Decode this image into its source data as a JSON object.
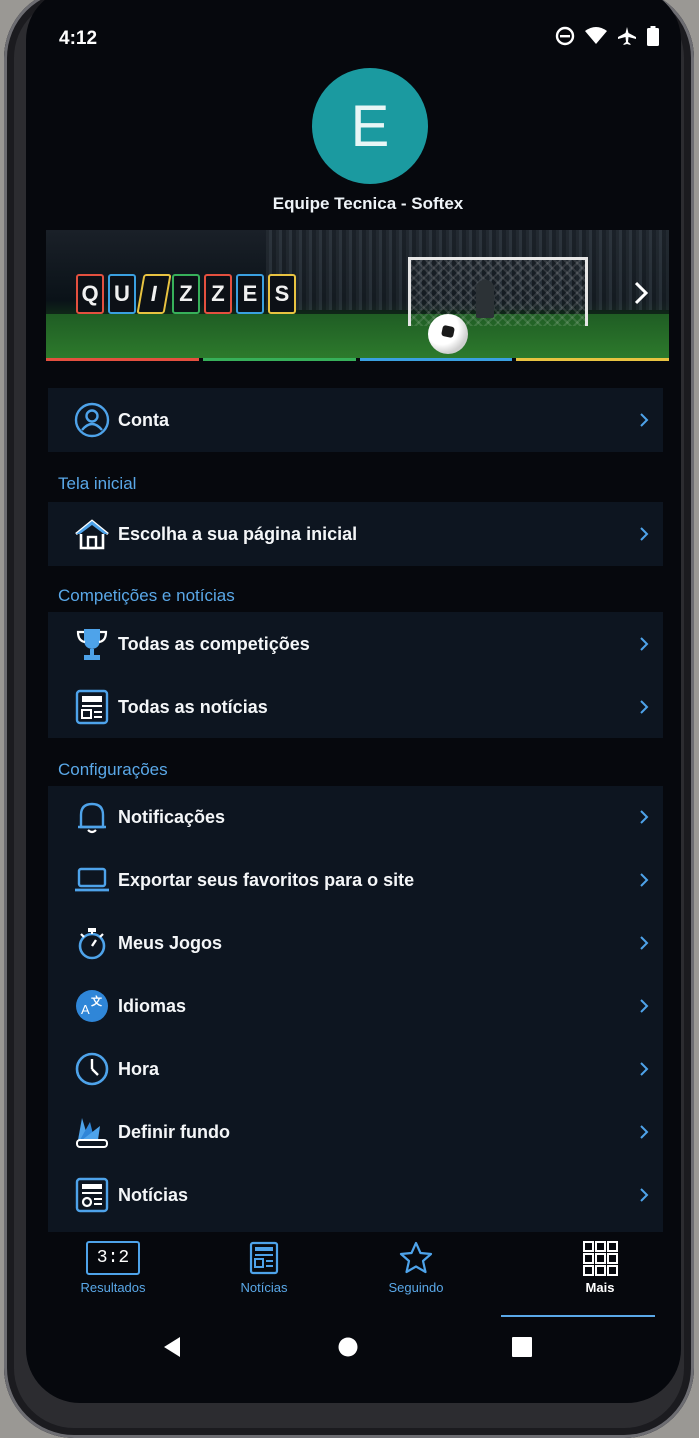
{
  "status_bar": {
    "time": "4:12",
    "icons": [
      "dnd-icon",
      "wifi-icon",
      "airplane-icon",
      "battery-icon"
    ]
  },
  "profile": {
    "initial": "E",
    "name": "Equipe Tecnica - Softex",
    "avatar_color": "#1b9aa0"
  },
  "banner": {
    "letters": [
      "Q",
      "U",
      "I",
      "Z",
      "Z",
      "E",
      "S"
    ],
    "letter_colors": [
      "#e4503f",
      "#3aa0e0",
      "#e8c341",
      "#37b05a",
      "#e4503f",
      "#3aa0e0",
      "#e8c341"
    ]
  },
  "stripe_colors": [
    "#e4503f",
    "#37b05a",
    "#3aa0e0",
    "#e8c341"
  ],
  "account": {
    "label": "Conta"
  },
  "sections": {
    "home": {
      "title": "Tela inicial",
      "item": "Escolha a sua página inicial"
    },
    "competitions": {
      "title": "Competições e notícias",
      "items": [
        "Todas as competições",
        "Todas as notícias"
      ]
    },
    "settings": {
      "title": "Configurações",
      "items": [
        "Notificações",
        "Exportar seus favoritos para o site",
        "Meus Jogos",
        "Idiomas",
        "Hora",
        "Definir fundo",
        "Notícias"
      ]
    }
  },
  "bottom_nav": {
    "items": [
      {
        "label": "Resultados",
        "icon": "scoreboard-icon",
        "score": "3:2"
      },
      {
        "label": "Notícias",
        "icon": "news-icon"
      },
      {
        "label": "Seguindo",
        "icon": "star-icon"
      },
      {
        "label": "Mais",
        "icon": "grid-icon",
        "active": true
      }
    ]
  },
  "colors": {
    "accent": "#5aa8e8",
    "background": "#06080d",
    "card": "#0d1520"
  }
}
